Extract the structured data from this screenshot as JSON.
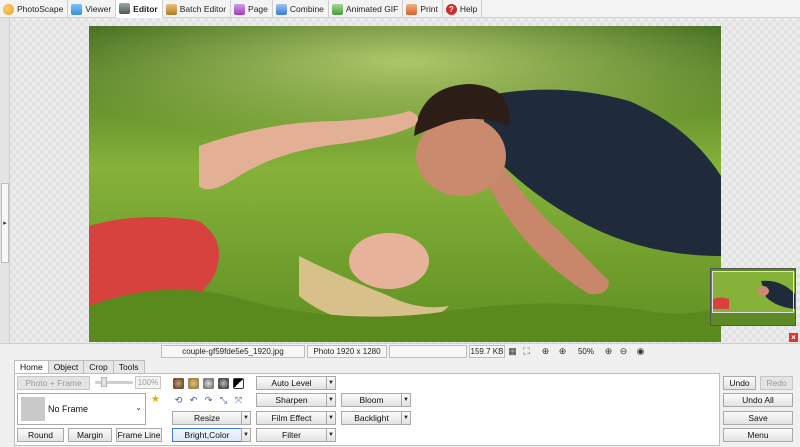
{
  "top_tabs": [
    {
      "label": "PhotoScape",
      "icon": "photoscape-icon",
      "color": "#e89a2a"
    },
    {
      "label": "Viewer",
      "icon": "viewer-icon",
      "color": "#3d8fd6"
    },
    {
      "label": "Editor",
      "icon": "editor-icon",
      "color": "#555555",
      "active": true
    },
    {
      "label": "Batch Editor",
      "icon": "batch-editor-icon",
      "color": "#b07a2a"
    },
    {
      "label": "Page",
      "icon": "page-icon",
      "color": "#9b3fbf"
    },
    {
      "label": "Combine",
      "icon": "combine-icon",
      "color": "#3a7bd5"
    },
    {
      "label": "Animated GIF",
      "icon": "animated-gif-icon",
      "color": "#4a9a3a"
    },
    {
      "label": "Print",
      "icon": "print-icon",
      "color": "#d3602a"
    },
    {
      "label": "Help",
      "icon": "help-icon",
      "color": "#d32a2a"
    }
  ],
  "status": {
    "filename": "couple-gf59fde5e5_1920.jpg",
    "photo_info": "Photo 1920 x 1280",
    "file_size": "159.7 KB",
    "zoom": "50%"
  },
  "panel": {
    "tabs": [
      "Home",
      "Object",
      "Crop",
      "Tools"
    ],
    "photo_frame_label": "Photo + Frame",
    "frame_zoom": "100%",
    "frame_name": "No Frame",
    "round": "Round",
    "margin": "Margin",
    "frame_line": "Frame Line",
    "resize": "Resize",
    "bright_color": "Bright,Color",
    "auto_level": "Auto Level",
    "sharpen": "Sharpen",
    "film_effect": "Film Effect",
    "filter": "Filter",
    "bloom": "Bloom",
    "backlight": "Backlight",
    "undo": "Undo",
    "redo": "Redo",
    "undo_all": "Undo All",
    "save": "Save",
    "menu": "Menu"
  },
  "colors": {
    "focus_border": "#3b78d8",
    "accent_red": "#d32a2a"
  }
}
